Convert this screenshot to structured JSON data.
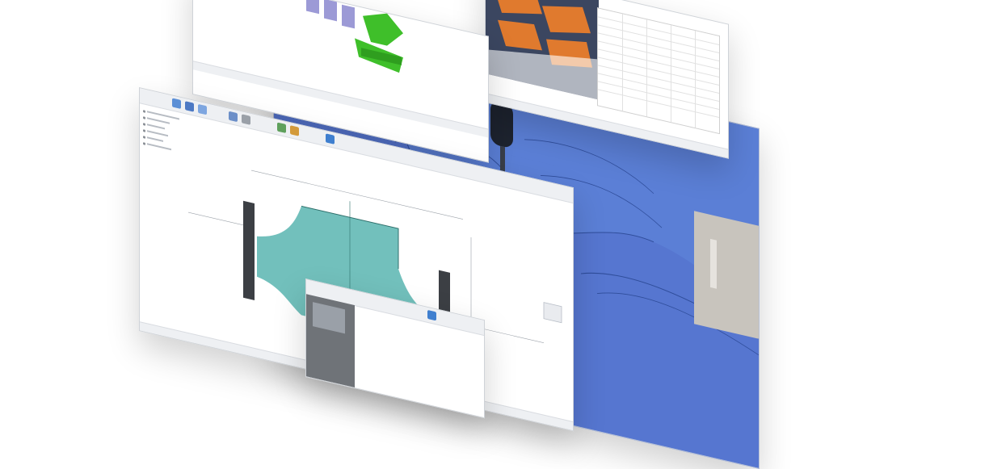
{
  "colors": {
    "surface_blue": "#5b7fd6",
    "part_teal": "#5fb7b3",
    "part_green": "#3fbf2a",
    "lattice_purple": "#9c9ad6",
    "orange_part": "#e07a2e",
    "window_bg": "#ffffff",
    "toolbar_bg": "#eef0f3"
  },
  "windows": [
    {
      "name": "machining-surface-window",
      "icon": "cnc-tool-icon"
    },
    {
      "name": "table-window",
      "icon": "table-icon"
    },
    {
      "name": "lattice-design-window",
      "icon": "lattice-part-icon"
    },
    {
      "name": "cad-part-window",
      "icon": "shaft-part-icon"
    },
    {
      "name": "browser-dialog-window",
      "icon": "dialog-icon"
    }
  ]
}
